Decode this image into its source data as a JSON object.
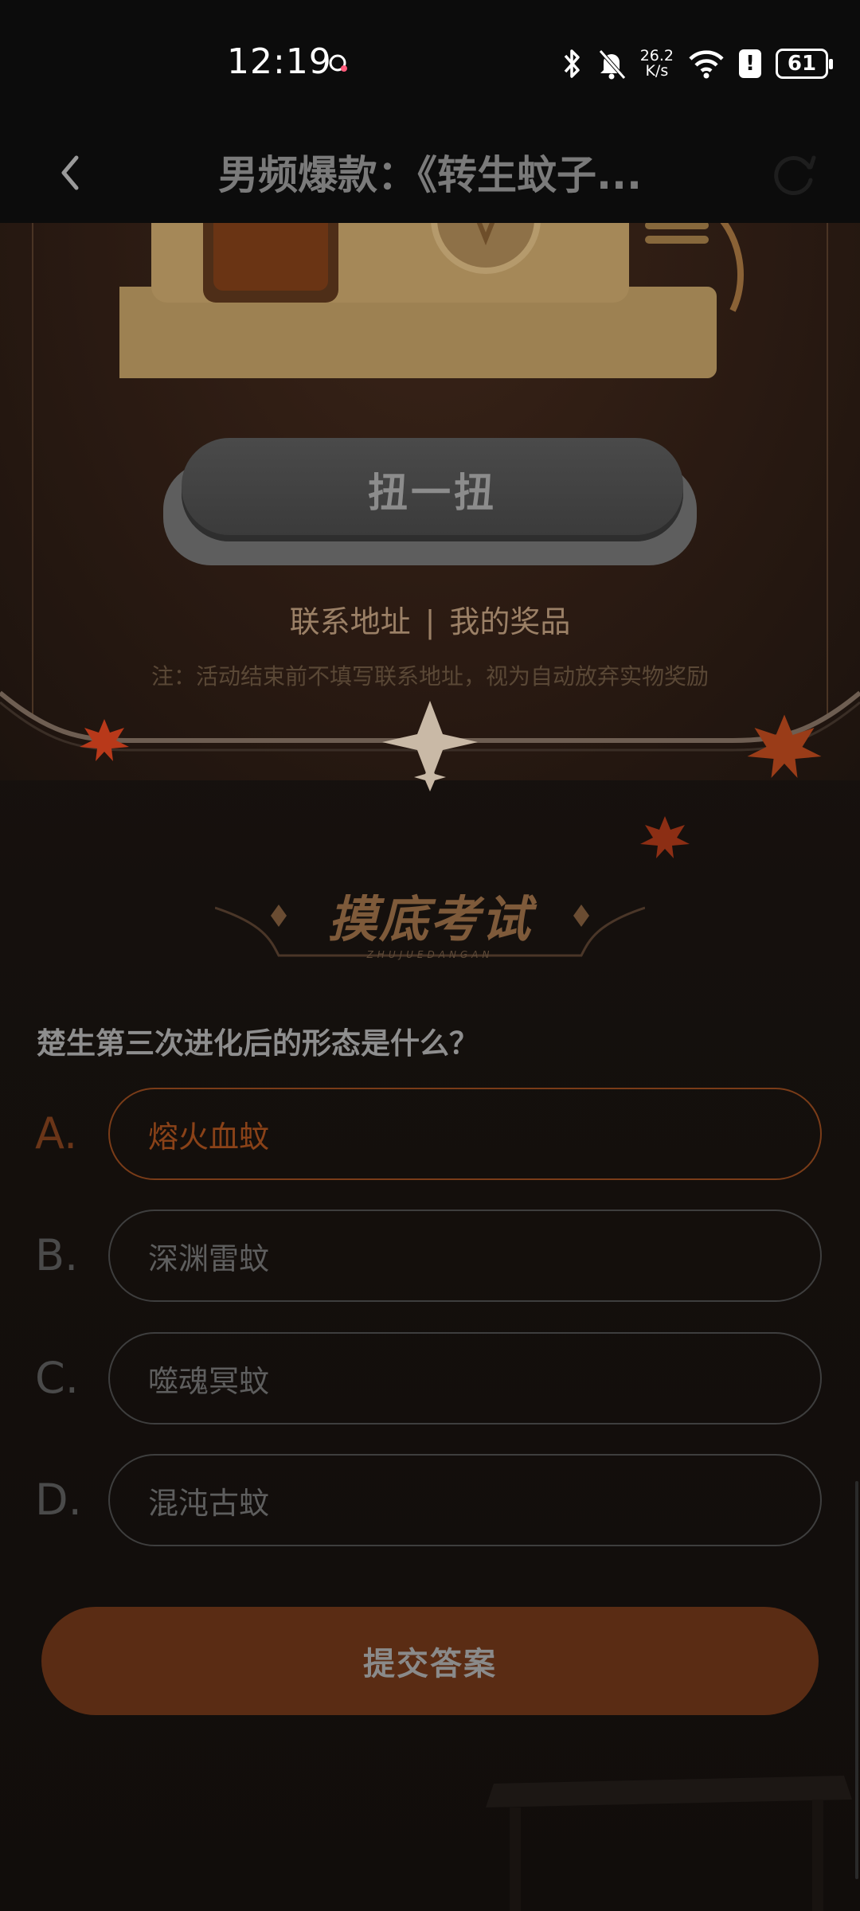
{
  "status_bar": {
    "time": "12:19",
    "net_speed_value": "26.2",
    "net_speed_unit": "K/s",
    "battery": "61",
    "icons": [
      "bluetooth-icon",
      "mute-bell-icon",
      "wifi-icon",
      "alert-icon",
      "battery-icon"
    ]
  },
  "nav": {
    "title": "男频爆款：《转生蚊子...",
    "back_icon": "chevron-left-icon",
    "refresh_icon": "refresh-icon"
  },
  "lottery": {
    "spin_label": "扭一扭",
    "link_address": "联系地址",
    "link_separator": "|",
    "link_prizes": "我的奖品",
    "notice": "注：活动结束前不填写联系地址，视为自动放弃实物奖励"
  },
  "exam": {
    "title": "摸底考试",
    "subtitle": "ZHUJUEDANGAN",
    "question": "楚生第三次进化后的形态是什么？",
    "options": [
      {
        "letter": "A.",
        "text": "熔火血蚊",
        "selected": true
      },
      {
        "letter": "B.",
        "text": "深渊雷蚊",
        "selected": false
      },
      {
        "letter": "C.",
        "text": "噬魂冥蚊",
        "selected": false
      },
      {
        "letter": "D.",
        "text": "混沌古蚊",
        "selected": false
      }
    ],
    "submit_label": "提交答案"
  },
  "colors": {
    "accent": "#8a4218",
    "submit_bg": "#5a2c14",
    "background": "#110d0b"
  }
}
